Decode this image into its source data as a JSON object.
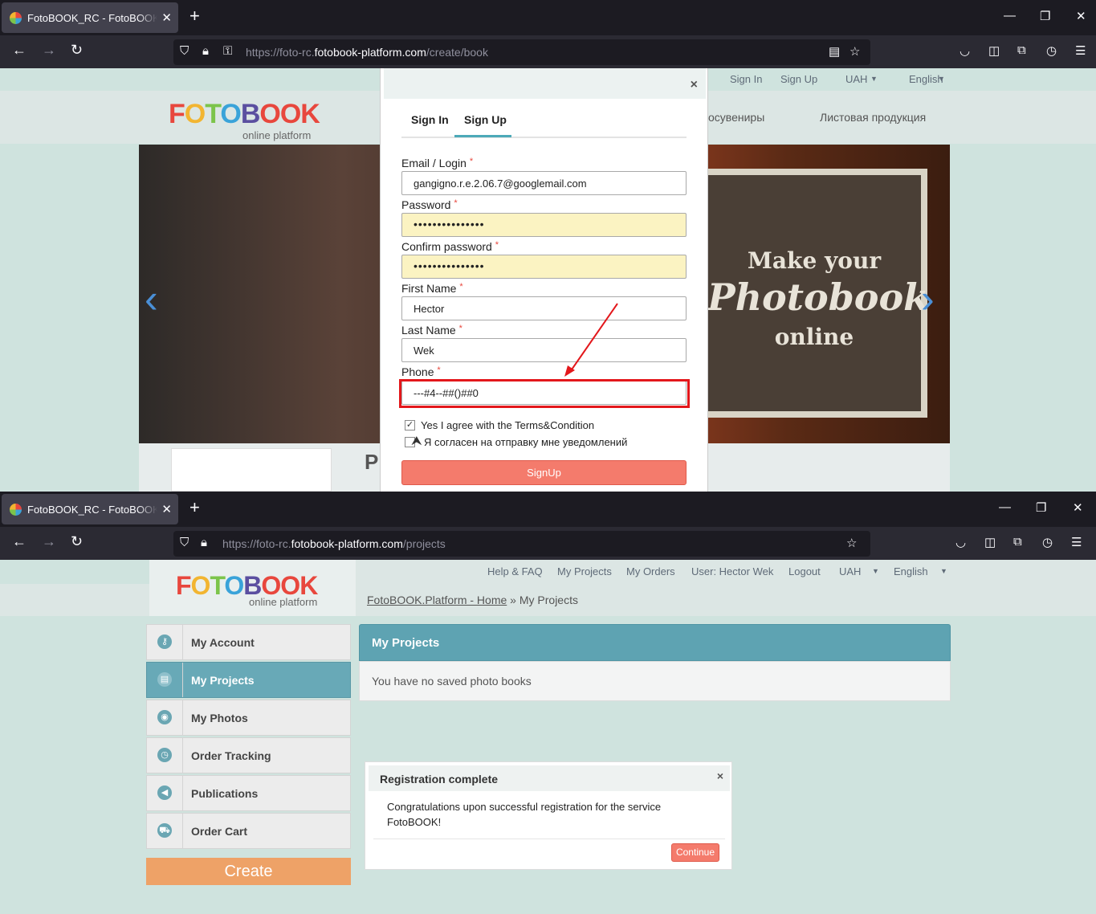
{
  "window1": {
    "tab_title": "FotoBOOK_RC - FotoBOOK.Platform",
    "url_prefix": "https://foto-rc.",
    "url_domain": "fotobook-platform.com",
    "url_path": "/create/book",
    "top_menu": [
      "Sign In",
      "Sign Up",
      "UAH",
      "English"
    ],
    "nav_items": [
      "осувениры",
      "Листовая продукция"
    ],
    "logo_text": "FOTOBOOK",
    "logo_sub": "online platform",
    "hero_line1": "Make your",
    "hero_line2": "Photobook",
    "hero_line3": "online",
    "below_heading": "P",
    "modal": {
      "close": "×",
      "tab_signin": "Sign In",
      "tab_signup": "Sign Up",
      "email_label": "Email / Login",
      "email_value": "gangigno.r.e.2.06.7@googlemail.com",
      "password_label": "Password",
      "password_value": "•••••••••••••••",
      "confirm_label": "Confirm password",
      "confirm_value": "•••••••••••••••",
      "first_name_label": "First Name",
      "first_name_value": "Hector",
      "last_name_label": "Last Name",
      "last_name_value": "Wek",
      "phone_label": "Phone",
      "phone_value": "---#4--##()##0",
      "required_mark": "*",
      "terms_label": "Yes I agree with the Terms&Condition",
      "terms_checked": true,
      "notify_label": "Я согласен на отправку мне уведомлений",
      "notify_checked": false,
      "signup_button": "SignUp"
    }
  },
  "window2": {
    "tab_title": "FotoBOOK_RC - FotoBOOK.Platform",
    "url_prefix": "https://foto-rc.",
    "url_domain": "fotobook-platform.com",
    "url_path": "/projects",
    "top_menu": [
      "Help & FAQ",
      "My Projects",
      "My Orders",
      "User: Hector Wek",
      "Logout",
      "UAH",
      "English"
    ],
    "logo_text": "FOTOBOOK",
    "logo_sub": "online platform",
    "breadcrumb_home": "FotoBOOK.Platform - Home",
    "breadcrumb_sep": "»",
    "breadcrumb_current": "My Projects",
    "sidebar": [
      {
        "label": "My Account",
        "icon": "key-icon"
      },
      {
        "label": "My Projects",
        "icon": "book-icon",
        "active": true
      },
      {
        "label": "My Photos",
        "icon": "camera-icon"
      },
      {
        "label": "Order Tracking",
        "icon": "clock-icon"
      },
      {
        "label": "Publications",
        "icon": "megaphone-icon"
      },
      {
        "label": "Order Cart",
        "icon": "cart-icon"
      }
    ],
    "create_button": "Create",
    "projects_title": "My Projects",
    "projects_empty": "You have no saved photo books",
    "dialog": {
      "title": "Registration complete",
      "close": "×",
      "message": "Congratulations upon successful registration for the service FotoBOOK!",
      "continue_button": "Continue"
    }
  },
  "colors": {
    "accent_teal": "#5ea3b2",
    "signup_red": "#f47b6c",
    "create_orange": "#eea267",
    "highlight_red": "#e3171b"
  }
}
